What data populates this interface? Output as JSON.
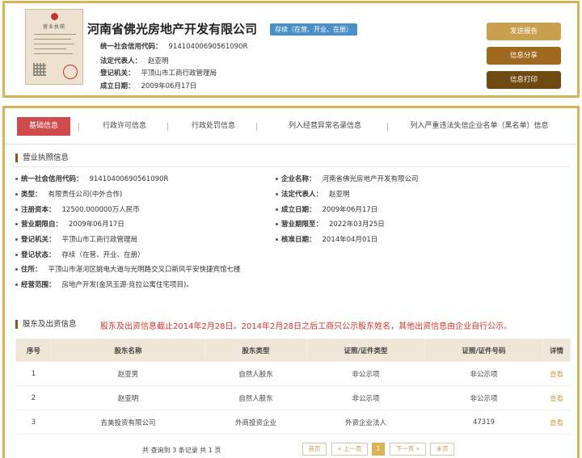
{
  "header": {
    "license_caption": "营业执照",
    "company_name": "河南省佛光房地产开发有限公司",
    "status": "存续（在营、开业、在册）",
    "rows": [
      {
        "key": "统一社会信用代码：",
        "value": "91410400690561090R"
      },
      {
        "key": "法定代表人：",
        "value": "赵亚明"
      },
      {
        "key": "登记机关：",
        "value": "平顶山市工商行政管理局"
      },
      {
        "key": "成立日期：",
        "value": "2009年06月17日"
      }
    ],
    "buttons": {
      "report": "发送报告",
      "share": "信息分享",
      "print": "信息打印"
    }
  },
  "tabs": [
    "基础信息",
    "行政许可信息",
    "行政处罚信息",
    "列入经营异常名录信息",
    "列入严重违法失信企业名单（黑名单）信息"
  ],
  "license_section": {
    "title": "营业执照信息",
    "fields": [
      {
        "key": "统一社会信用代码：",
        "value": "91410400690561090R"
      },
      {
        "key": "企业名称：",
        "value": "河南省佛光房地产开发有限公司"
      },
      {
        "key": "类型：",
        "value": "有限责任公司(中外合作)"
      },
      {
        "key": "法定代表人：",
        "value": "赵亚明"
      },
      {
        "key": "注册资本：",
        "value": "12500.000000万人民币"
      },
      {
        "key": "成立日期：",
        "value": "2009年06月17日"
      },
      {
        "key": "营业期限自：",
        "value": "2009年06月17日"
      },
      {
        "key": "营业期限至：",
        "value": "2022年03月25日"
      },
      {
        "key": "登记机关：",
        "value": "平顶山市工商行政管理局"
      },
      {
        "key": "核准日期：",
        "value": "2014年04月01日"
      },
      {
        "key": "登记状态：",
        "value": "存续（在营、开业、在册）"
      },
      {
        "key": "住所：",
        "value": "平顶山市湛河区姚电大道与光明路交叉口新风平安快捷宾馆七楼"
      },
      {
        "key": "经营范围：",
        "value": "房地产开发(金凤玉源·竞拉公寓住宅项目)。"
      }
    ]
  },
  "shareholder_section": {
    "title": "股东及出资信息",
    "note": "股东及出资信息截止2014年2月28日。2014年2月28日之后工商只公示股东姓名，其他出资信息由企业自行公示。",
    "columns": [
      "序号",
      "股东名称",
      "股东类型",
      "证照/证件类型",
      "证照/证件号码",
      "详情"
    ],
    "rows": [
      [
        "1",
        "赵亚男",
        "自然人股东",
        "非公示项",
        "非公示项",
        "查看"
      ],
      [
        "2",
        "赵亚明",
        "自然人股东",
        "非公示项",
        "非公示项",
        "查看"
      ],
      [
        "3",
        "吉美投资有限公司",
        "外商投资企业",
        "外资企业法人",
        "47319",
        "查看"
      ]
    ],
    "pager": {
      "summary": "共 查询到 3 条记录 共 1 页",
      "first": "首页",
      "prev": "« 上一页",
      "current": "1",
      "next": "下一页 »",
      "last": "末页"
    }
  }
}
